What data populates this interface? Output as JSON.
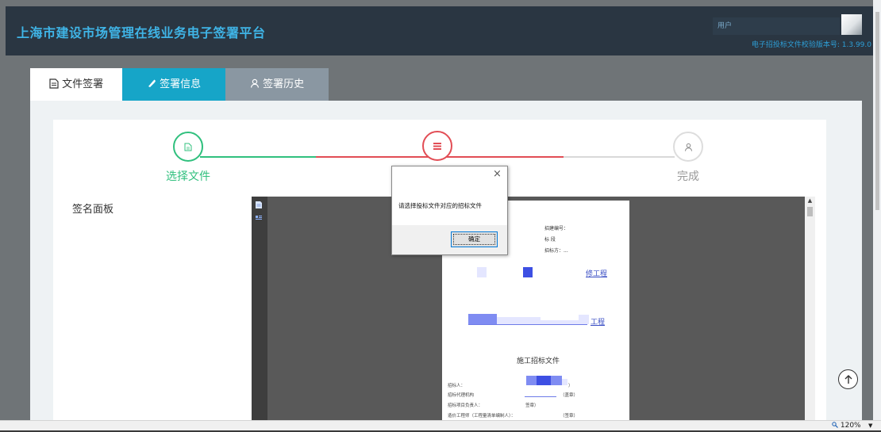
{
  "header": {
    "title": "上海市建设市场管理在线业务电子签署平台",
    "user": "用户",
    "version_label": "电子招投标文件校验版本号: 1.3.99.0"
  },
  "tabs": [
    {
      "label": "文件签署",
      "icon": "document-icon",
      "active": true
    },
    {
      "label": "签署信息",
      "icon": "pen-icon",
      "active": false
    },
    {
      "label": "签署历史",
      "icon": "user-icon",
      "active": false
    }
  ],
  "steps": [
    {
      "label": "选择文件",
      "state": "done",
      "color": "#30c07e"
    },
    {
      "label": "",
      "state": "current",
      "color": "#e24d55"
    },
    {
      "label": "完成",
      "state": "pending",
      "color": "#dddddd"
    }
  ],
  "panel": {
    "label": "签名面板"
  },
  "document": {
    "meta": [
      "招建编号：",
      "标 段",
      "招标方：..."
    ],
    "project_line1": "修工程",
    "project_line2": "工程",
    "heading": "施工招标文件",
    "fields": [
      "招标人：",
      "招标代理机构",
      "招标项目负责人：",
      "造价工程师（工程量清单编制人）："
    ],
    "field_suffixes": [
      "）",
      "（盖章）",
      "签章）",
      "（签章）"
    ]
  },
  "dialog": {
    "close": "×",
    "message": "请选择投标文件对应的招标文件",
    "ok": "确定"
  },
  "status": {
    "zoom": "120%"
  },
  "colors": {
    "accent": "#16a5c8",
    "success": "#30c07e",
    "danger": "#e24d55",
    "header_bg": "#2a3642"
  }
}
